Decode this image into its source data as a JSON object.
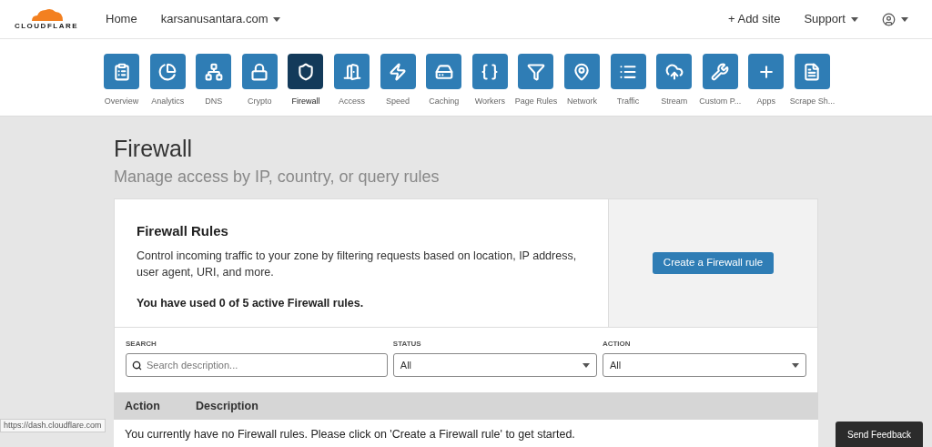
{
  "header": {
    "logo": "CLOUDFLARE",
    "home": "Home",
    "site": "karsanusantara.com",
    "add_site": "+ Add site",
    "support": "Support"
  },
  "nav": [
    {
      "label": "Overview",
      "selected": false
    },
    {
      "label": "Analytics",
      "selected": false
    },
    {
      "label": "DNS",
      "selected": false
    },
    {
      "label": "Crypto",
      "selected": false
    },
    {
      "label": "Firewall",
      "selected": true
    },
    {
      "label": "Access",
      "selected": false
    },
    {
      "label": "Speed",
      "selected": false
    },
    {
      "label": "Caching",
      "selected": false
    },
    {
      "label": "Workers",
      "selected": false
    },
    {
      "label": "Page Rules",
      "selected": false
    },
    {
      "label": "Network",
      "selected": false
    },
    {
      "label": "Traffic",
      "selected": false
    },
    {
      "label": "Stream",
      "selected": false
    },
    {
      "label": "Custom P...",
      "selected": false
    },
    {
      "label": "Apps",
      "selected": false
    },
    {
      "label": "Scrape Sh...",
      "selected": false
    }
  ],
  "page": {
    "title": "Firewall",
    "subtitle": "Manage access by IP, country, or query rules"
  },
  "rules_card": {
    "title": "Firewall Rules",
    "description": "Control incoming traffic to your zone by filtering requests based on location, IP address, user agent, URI, and more.",
    "usage": "You have used 0 of 5 active Firewall rules.",
    "button": "Create a Firewall rule"
  },
  "filters": {
    "search": {
      "label": "SEARCH",
      "placeholder": "Search description..."
    },
    "status": {
      "label": "STATUS",
      "value": "All"
    },
    "action": {
      "label": "ACTION",
      "value": "All"
    }
  },
  "table": {
    "columns": [
      "Action",
      "Description"
    ],
    "empty_message": "You currently have no Firewall rules. Please click on 'Create a Firewall rule' to get started."
  },
  "status_url": "https://dash.cloudflare.com",
  "feedback_button": "Send Feedback"
}
